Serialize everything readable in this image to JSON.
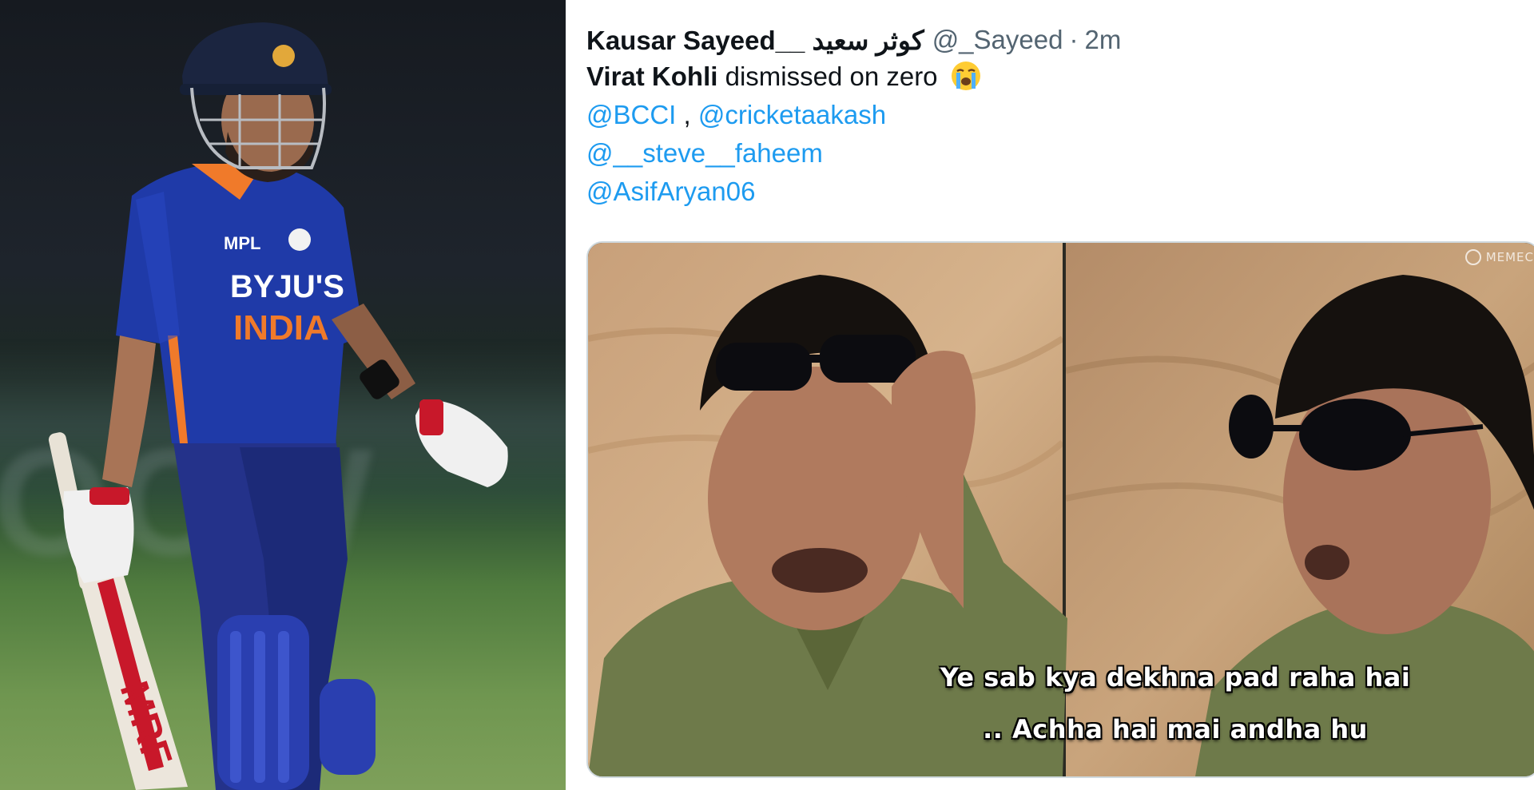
{
  "tweet": {
    "display_name": "Kausar Sayeed__ كوثر سعيد",
    "handle": "@_Sayeed",
    "separator": "·",
    "time": "2m",
    "more_menu": "·",
    "text_name": "Virat Kohli",
    "text_rest": " dismissed on zero",
    "emoji": "loudly-crying-face-emoji",
    "mentions": [
      "@BCCI",
      "@cricketaakash",
      "@__steve__faheem",
      "@AsifAryan06"
    ],
    "mention_comma": " , "
  },
  "meme": {
    "caption_line1": "Ye sab kya dekhna pad raha hai",
    "caption_line2": ".. Achha hai mai andha hu",
    "watermark": "MEMEC"
  },
  "photo": {
    "jersey_sponsor": "BYJU'S",
    "jersey_team": "INDIA",
    "jersey_kit": "MPL",
    "bat_brand": "MRF",
    "background_letters": "OCW"
  },
  "colors": {
    "mention_blue": "#1d9bf0",
    "jersey_blue": "#1f3aa8",
    "jersey_orange": "#f07a2a",
    "text_primary": "#0f1419",
    "text_secondary": "#536471"
  }
}
